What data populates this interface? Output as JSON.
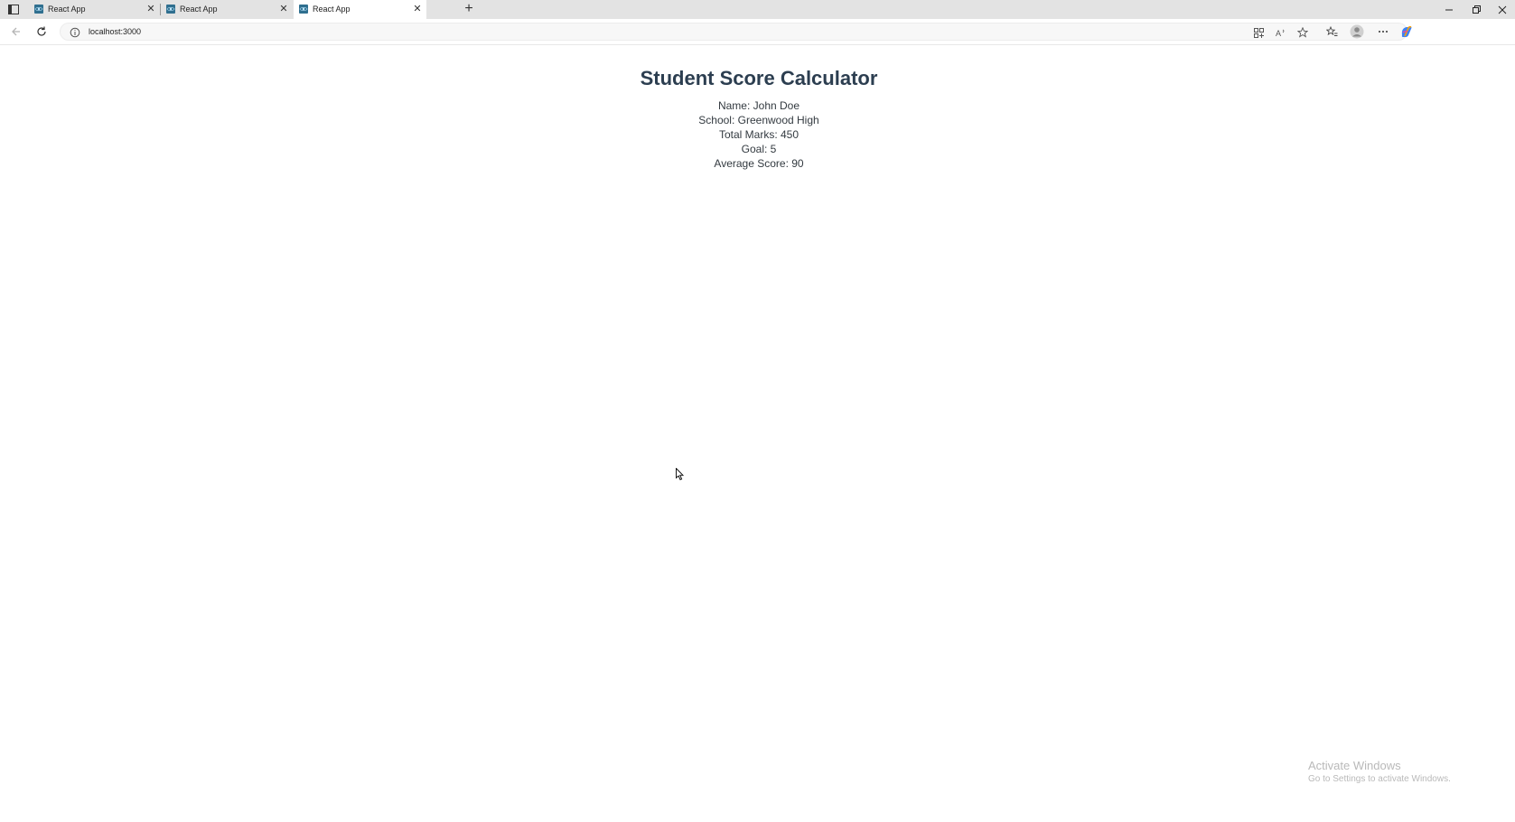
{
  "browser": {
    "tabs": [
      {
        "title": "React App",
        "active": false
      },
      {
        "title": "React App",
        "active": false
      },
      {
        "title": "React App",
        "active": true
      }
    ],
    "url": "localhost:3000"
  },
  "page": {
    "title": "Student Score Calculator",
    "lines": [
      "Name: John Doe",
      "School: Greenwood High",
      "Total Marks: 450",
      "Goal: 5",
      "Average Score: 90"
    ]
  },
  "watermark": {
    "title": "Activate Windows",
    "subtitle": "Go to Settings to activate Windows."
  },
  "colors": {
    "heading": "#2c3e50",
    "react_favicon": "#2f6f8f"
  }
}
